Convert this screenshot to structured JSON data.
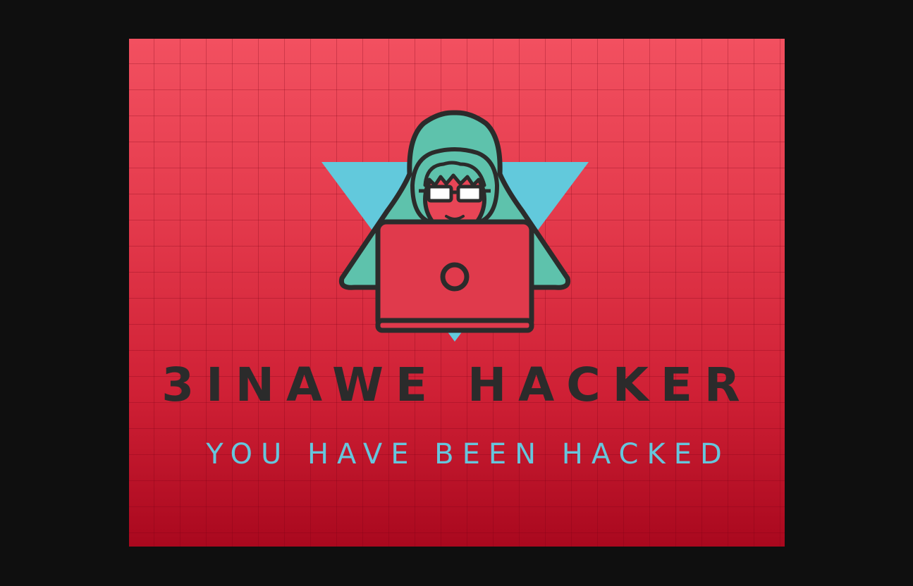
{
  "viewer": {
    "background_color": "#0f0f0f"
  },
  "image": {
    "icon": "hooded-hacker-laptop-icon",
    "title": "3INAWE HACKER",
    "tagline": "YOU HAVE BEEN HACKED",
    "colors": {
      "background_top": "#f25060",
      "background_bottom": "#a9081e",
      "title_text": "#2b2b2b",
      "tagline_text": "#66c6dd",
      "triangle": "#62c9dc",
      "hood": "#5ec2ac",
      "outline": "#2b2b2b"
    }
  }
}
